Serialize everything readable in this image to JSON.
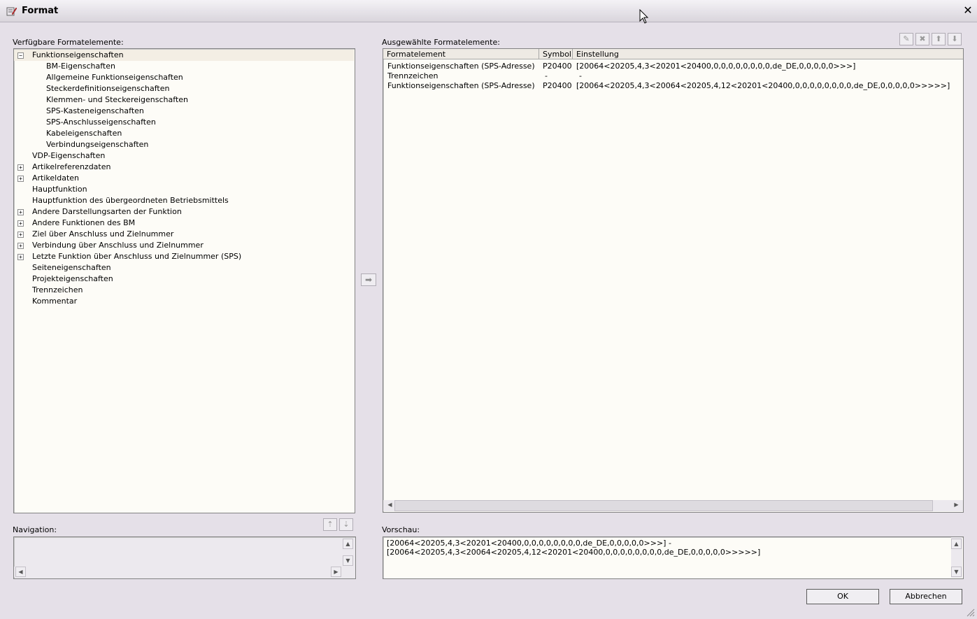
{
  "window": {
    "title": "Format"
  },
  "left": {
    "label": "Verfügbare Formatelemente:",
    "tree": [
      {
        "label": "Funktionseigenschaften",
        "level": 0,
        "expander": "minus",
        "selected": true
      },
      {
        "label": "BM-Eigenschaften",
        "level": 1,
        "expander": ""
      },
      {
        "label": "Allgemeine Funktionseigenschaften",
        "level": 1,
        "expander": ""
      },
      {
        "label": "Steckerdefinitionseigenschaften",
        "level": 1,
        "expander": ""
      },
      {
        "label": "Klemmen- und Steckereigenschaften",
        "level": 1,
        "expander": ""
      },
      {
        "label": "SPS-Kasteneigenschaften",
        "level": 1,
        "expander": ""
      },
      {
        "label": "SPS-Anschlusseigenschaften",
        "level": 1,
        "expander": ""
      },
      {
        "label": "Kabeleigenschaften",
        "level": 1,
        "expander": ""
      },
      {
        "label": "Verbindungseigenschaften",
        "level": 1,
        "expander": ""
      },
      {
        "label": "VDP-Eigenschaften",
        "level": 0,
        "expander": ""
      },
      {
        "label": "Artikelreferenzdaten",
        "level": 0,
        "expander": "plus"
      },
      {
        "label": "Artikeldaten",
        "level": 0,
        "expander": "plus"
      },
      {
        "label": "Hauptfunktion",
        "level": 0,
        "expander": ""
      },
      {
        "label": "Hauptfunktion des übergeordneten Betriebsmittels",
        "level": 0,
        "expander": ""
      },
      {
        "label": "Andere Darstellungsarten der Funktion",
        "level": 0,
        "expander": "plus"
      },
      {
        "label": "Andere Funktionen des BM",
        "level": 0,
        "expander": "plus"
      },
      {
        "label": "Ziel über Anschluss und Zielnummer",
        "level": 0,
        "expander": "plus"
      },
      {
        "label": "Verbindung über Anschluss und Zielnummer",
        "level": 0,
        "expander": "plus"
      },
      {
        "label": "Letzte Funktion über Anschluss und Zielnummer (SPS)",
        "level": 0,
        "expander": "plus"
      },
      {
        "label": "Seiteneigenschaften",
        "level": 0,
        "expander": ""
      },
      {
        "label": "Projekteigenschaften",
        "level": 0,
        "expander": ""
      },
      {
        "label": "Trennzeichen",
        "level": 0,
        "expander": ""
      },
      {
        "label": "Kommentar",
        "level": 0,
        "expander": ""
      }
    ],
    "navigation_label": "Navigation:"
  },
  "right": {
    "label": "Ausgewählte Formatelemente:",
    "columns": [
      "Formatelement",
      "Symbol",
      "Einstellung"
    ],
    "rows": [
      {
        "element": "Funktionseigenschaften (SPS-Adresse)",
        "symbol": "P20400",
        "setting": "[20064<20205,4,3<20201<20400,0,0,0,0,0,0,0,0,de_DE,0,0,0,0,0>>>]"
      },
      {
        "element": "Trennzeichen",
        "symbol": "-",
        "setting": "-"
      },
      {
        "element": "Funktionseigenschaften (SPS-Adresse)",
        "symbol": "P20400",
        "setting": "[20064<20205,4,3<20064<20205,4,12<20201<20400,0,0,0,0,0,0,0,0,de_DE,0,0,0,0,0>>>>>]"
      }
    ],
    "preview_label": "Vorschau:",
    "preview_lines": [
      "[20064<20205,4,3<20201<20400,0,0,0,0,0,0,0,0,de_DE,0,0,0,0,0>>>] -",
      "[20064<20205,4,3<20064<20205,4,12<20201<20400,0,0,0,0,0,0,0,0,de_DE,0,0,0,0,0>>>>>]"
    ]
  },
  "buttons": {
    "ok": "OK",
    "cancel": "Abbrechen"
  },
  "icons": {
    "toolbar": [
      "edit-icon",
      "delete-icon",
      "move-up-icon",
      "move-down-icon"
    ],
    "navigation": [
      "navigate-up-icon",
      "navigate-down-icon"
    ],
    "transfer": "arrow-right-icon"
  }
}
